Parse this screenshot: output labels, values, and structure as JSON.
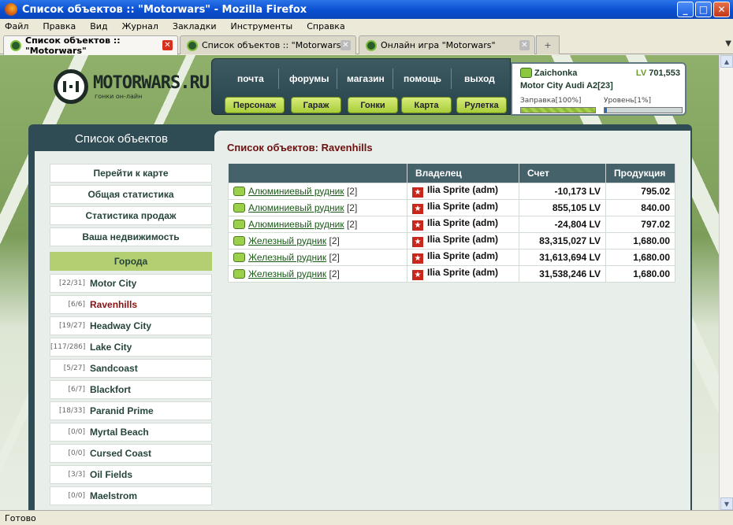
{
  "window": {
    "title": "Список объектов :: \"Motorwars\" - Mozilla Firefox"
  },
  "menu": [
    "Файл",
    "Правка",
    "Вид",
    "Журнал",
    "Закладки",
    "Инструменты",
    "Справка"
  ],
  "tabs": [
    {
      "label": "Список объектов :: \"Motorwars\""
    },
    {
      "label": "Список объектов :: \"Motorwars\""
    },
    {
      "label": "Онлайн игра \"Motorwars\""
    }
  ],
  "status": "Готово",
  "site": {
    "logo": "MOTORWARS.RU",
    "tagline": "гонки он-лайн",
    "nav_top": [
      "почта",
      "форумы",
      "магазин",
      "помощь",
      "выход"
    ],
    "nav_buttons": [
      "Персонаж",
      "Гараж",
      "Гонки",
      "Карта",
      "Рулетка"
    ]
  },
  "user": {
    "name": "Zaichonka",
    "lv_label": "LV",
    "money": "701,553",
    "car": "Motor City Audi A2[23]",
    "fuel_label": "Заправка[100%]",
    "fuel": 1.0,
    "level_label": "Уровень[1%]",
    "level": 0.01
  },
  "sidebar": {
    "title": "Список объектов",
    "links": [
      "Перейти к карте",
      "Общая статистика",
      "Статистика продаж",
      "Ваша недвижимость"
    ],
    "cities_header": "Города",
    "cities": [
      {
        "count": "[22/31]",
        "name": "Motor City"
      },
      {
        "count": "[6/6]",
        "name": "Ravenhills"
      },
      {
        "count": "[19/27]",
        "name": "Headway City"
      },
      {
        "count": "[117/286]",
        "name": "Lake City"
      },
      {
        "count": "[5/27]",
        "name": "Sandcoast"
      },
      {
        "count": "[6/7]",
        "name": "Blackfort"
      },
      {
        "count": "[18/33]",
        "name": "Paranid Prime"
      },
      {
        "count": "[0/0]",
        "name": "Myrtal Beach"
      },
      {
        "count": "[0/0]",
        "name": "Cursed Coast"
      },
      {
        "count": "[3/3]",
        "name": "Oil Fields"
      },
      {
        "count": "[0/0]",
        "name": "Maelstrom"
      }
    ]
  },
  "content": {
    "title": "Список объектов: Ravenhills",
    "columns": [
      "",
      "Владелец",
      "Счет",
      "Продукция"
    ],
    "rows": [
      {
        "name": "Алюминиевый рудник",
        "count": "[2]",
        "owner": "Ilia Sprite (adm)",
        "account": "-10,173 LV",
        "production": "795.02"
      },
      {
        "name": "Алюминиевый рудник",
        "count": "[2]",
        "owner": "Ilia Sprite (adm)",
        "account": "855,105 LV",
        "production": "840.00"
      },
      {
        "name": "Алюминиевый рудник",
        "count": "[2]",
        "owner": "Ilia Sprite (adm)",
        "account": "-24,804 LV",
        "production": "797.02"
      },
      {
        "name": "Железный рудник",
        "count": "[2]",
        "owner": "Ilia Sprite (adm)",
        "account": "83,315,027 LV",
        "production": "1,680.00"
      },
      {
        "name": "Железный рудник",
        "count": "[2]",
        "owner": "Ilia Sprite (adm)",
        "account": "31,613,694 LV",
        "production": "1,680.00"
      },
      {
        "name": "Железный рудник",
        "count": "[2]",
        "owner": "Ilia Sprite (adm)",
        "account": "31,538,246 LV",
        "production": "1,680.00"
      }
    ]
  },
  "colors": {
    "accent_green": "#b4cf72",
    "panel": "#2f4c55",
    "owner_star": "#c8281c"
  }
}
